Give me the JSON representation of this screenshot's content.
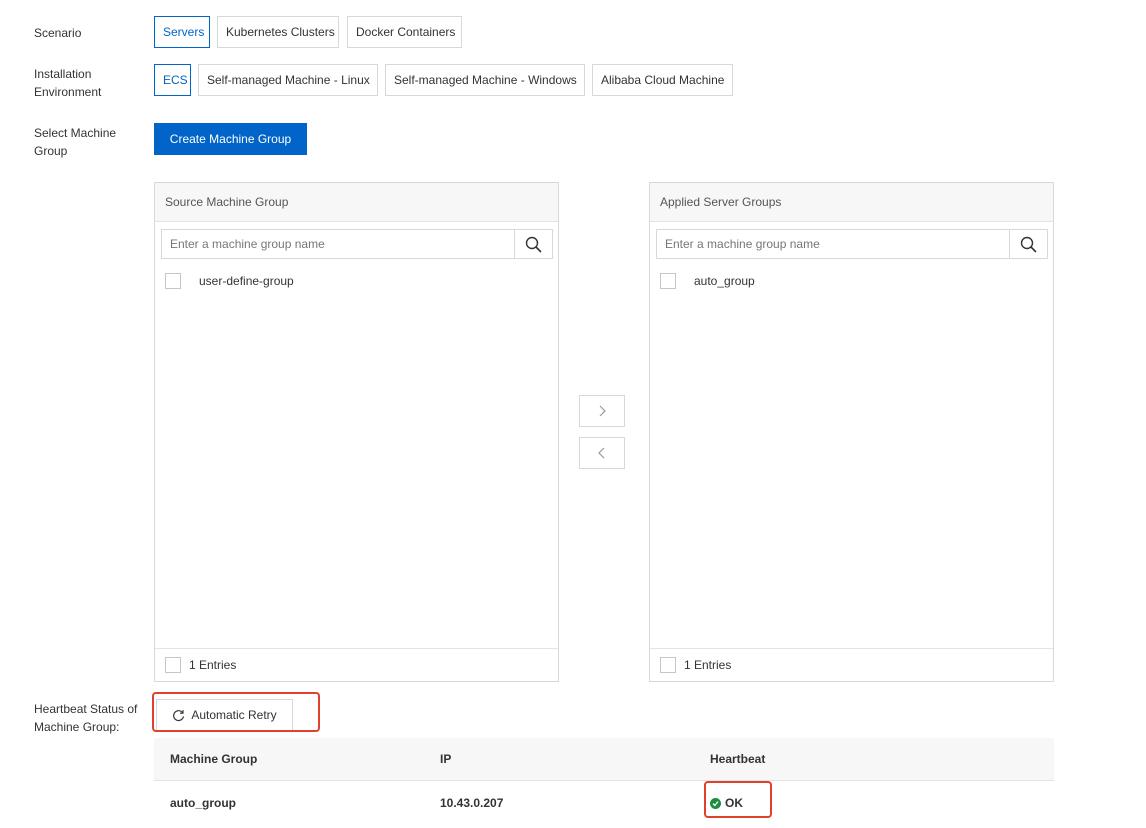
{
  "scenario": {
    "label": "Scenario",
    "options": [
      "Servers",
      "Kubernetes Clusters",
      "Docker Containers"
    ],
    "selected": "Servers"
  },
  "installation_environment": {
    "label_line1": "Installation",
    "label_line2": "Environment",
    "options": [
      "ECS",
      "Self-managed Machine - Linux",
      "Self-managed Machine - Windows",
      "Alibaba Cloud Machine"
    ],
    "selected": "ECS"
  },
  "machine_group": {
    "label_line1": "Select Machine",
    "label_line2": "Group",
    "create_button": "Create Machine Group"
  },
  "source_panel": {
    "title": "Source Machine Group",
    "search_placeholder": "Enter a machine group name",
    "items": [
      "user-define-group"
    ],
    "footer": "1 Entries"
  },
  "applied_panel": {
    "title": "Applied Server Groups",
    "search_placeholder": "Enter a machine group name",
    "items": [
      "auto_group"
    ],
    "footer": "1 Entries"
  },
  "transfer": {
    "right_arrow": ">",
    "left_arrow": "<"
  },
  "heartbeat": {
    "label_line1": "Heartbeat Status of",
    "label_line2": "Machine Group:",
    "retry_button": "Automatic Retry",
    "columns": [
      "Machine Group",
      "IP",
      "Heartbeat"
    ],
    "rows": [
      {
        "machine_group": "auto_group",
        "ip": "10.43.0.207",
        "heartbeat": "OK"
      }
    ]
  },
  "colors": {
    "primary": "#0064c8",
    "highlight": "#e0402e",
    "status_ok": "#1e8e3e"
  }
}
